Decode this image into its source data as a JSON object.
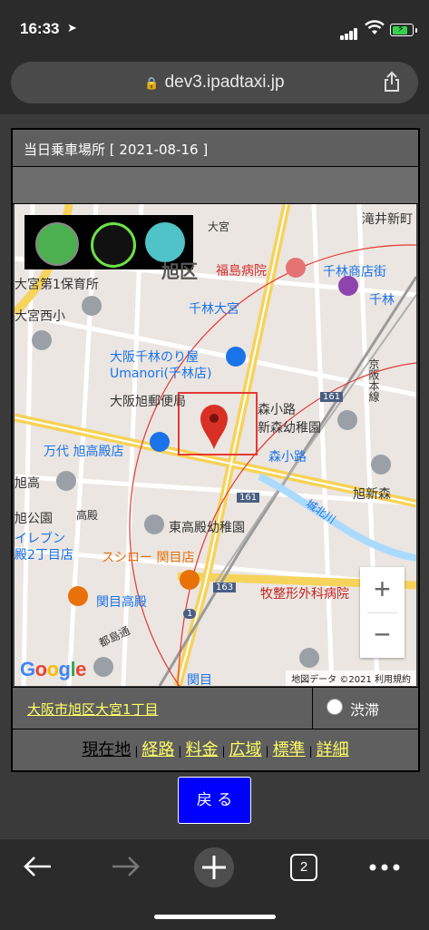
{
  "status": {
    "time": "16:33"
  },
  "browser": {
    "url": "dev3.ipadtaxi.jp",
    "tab_count": "2"
  },
  "page": {
    "header_title": "当日乗車場所 [ 2021-08-16 ]",
    "address": "大阪市旭区大宮1丁目",
    "traffic_label": "渋滞",
    "menu": [
      "現在地",
      "経路",
      "料金",
      "広域",
      "標準",
      "詳細"
    ],
    "back_label": "戻 る"
  },
  "map": {
    "labels": {
      "takii": "滝井新町",
      "omiya": "大宮",
      "asahi": "旭区",
      "nursery1": "大宮第1保育所",
      "omiya_west": "大宮西小",
      "fukushima": "福島病院",
      "senbayashi_st": "千林商店街",
      "senbayashi_omiya": "千林大宮",
      "senbayashi": "千林",
      "umanori1": "大阪千林のり屋",
      "umanori2": "Umanori(千林店)",
      "keihan": "京阪本線",
      "post": "大阪旭郵便局",
      "morishoji": "森小路",
      "shinmori": "新森幼稚園",
      "mandai": "万代 旭高殿店",
      "morishoji_st": "森小路",
      "asahi_w": "旭高",
      "takadono": "高殿",
      "asahi_park": "旭公園",
      "eleven": "イレブン",
      "dono2": "殿2丁目店",
      "higashitakadono": "東高殿幼稚園",
      "shinmorimiya": "旭新森",
      "route161": "161",
      "route161b": "161",
      "route163": "163",
      "route1": "1",
      "sushiro": "スシロー 関目店",
      "seikei": "牧整形外科病院",
      "sekime_takadono": "関目高殿",
      "miyakojima": "都島通",
      "sekime": "関目",
      "kobashi": "城北川"
    },
    "google_logo": "Google",
    "attribution": "地図データ ©2021   利用規約",
    "zoom_in": "+",
    "zoom_out": "−"
  },
  "colors": {
    "accent_yellow": "#ffff66",
    "back_button": "#0000ff",
    "pin": "#d93025",
    "box": "#e53935"
  }
}
